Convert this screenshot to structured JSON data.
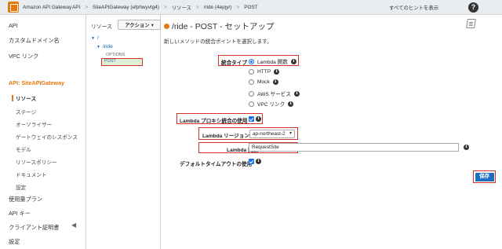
{
  "header": {
    "brand": "Amazon API Gateway",
    "breadcrumbs": [
      "API",
      "SiteAPIGateway (efphwyvtg4)",
      "リソース",
      "/ride (4epjyr)",
      "POST"
    ],
    "separator": ">",
    "hints_link": "すべてのヒントを表示",
    "help_icon": "?"
  },
  "sidebar": {
    "top_items": [
      "API",
      "カスタムドメイン名",
      "VPC リンク"
    ],
    "api_label": "API: SiteAPIGateway",
    "api_sub_items": [
      "リソース",
      "ステージ",
      "オーソライザー",
      "ゲートウェイのレスポンス",
      "モデル",
      "リソースポリシー",
      "ドキュメント",
      "設定"
    ],
    "bottom_items": [
      "使用量プラン",
      "API キー",
      "クライアント証明書",
      "設定"
    ],
    "collapse_icon": "◀"
  },
  "tree": {
    "header_label": "リソース",
    "actions_button": "アクション",
    "root": "/",
    "ride": "/ride",
    "options": "OPTIONS",
    "post": "POST"
  },
  "main": {
    "title": "/ride - POST - セットアップ",
    "subtitle": "新しいメソッドの統合ポイントを選択します。",
    "integration_type_label": "統合タイプ",
    "integration_options": [
      "Lambda 関数",
      "HTTP",
      "Mock",
      "AWS サービス",
      "VPC リンク"
    ],
    "selected_option": "Lambda 関数",
    "proxy_label": "Lambda プロキシ統合の使用",
    "proxy_checked": true,
    "region_label": "Lambda リージョン",
    "region_value": "ap-northeast-2",
    "function_label": "Lambda 関数",
    "function_value": "RequestSite",
    "timeout_label": "デフォルトタイムアウトの使用",
    "timeout_checked": true,
    "save_button": "保存",
    "info_icon": "i"
  },
  "colors": {
    "accent": "#e47911",
    "highlight_border": "#d6322d",
    "primary_button": "#1f6fc0",
    "link": "#1166bb"
  }
}
